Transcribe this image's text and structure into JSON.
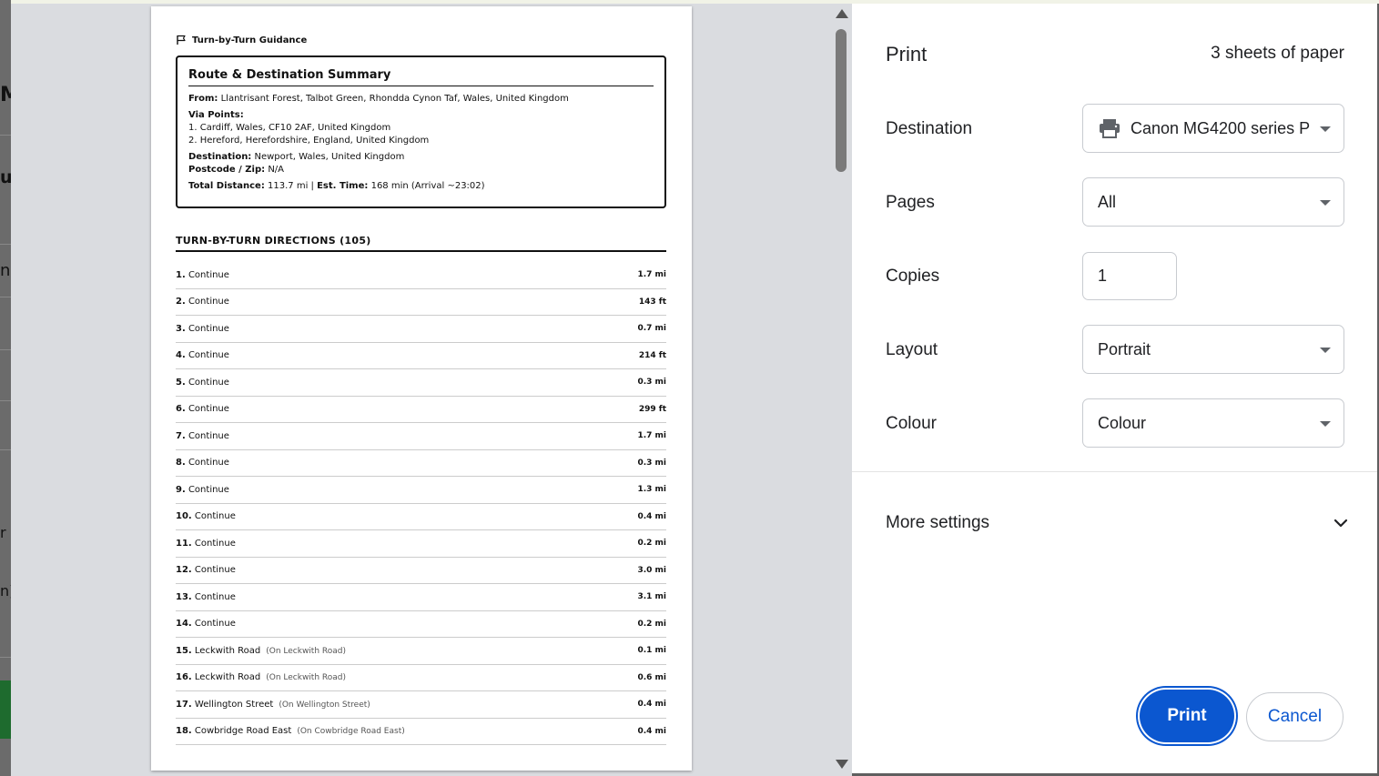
{
  "background_page": {
    "fragments": [
      "M",
      "u",
      "n",
      "r",
      "n)"
    ]
  },
  "preview": {
    "header": "Turn-by-Turn Guidance",
    "summary": {
      "title": "Route & Destination Summary",
      "from_label": "From:",
      "from_value": "Llantrisant Forest, Talbot Green, Rhondda Cynon Taf, Wales, United Kingdom",
      "via_label": "Via Points:",
      "via_1": "1. Cardiff, Wales, CF10 2AF, United Kingdom",
      "via_2": "2. Hereford, Herefordshire, England, United Kingdom",
      "dest_label": "Destination:",
      "dest_value": "Newport, Wales, United Kingdom",
      "postcode_label": "Postcode / Zip:",
      "postcode_value": "N/A",
      "distance_label": "Total Distance:",
      "distance_value": "113.7 mi |",
      "time_label": "Est. Time:",
      "time_value": "168 min (Arrival ~23:02)"
    },
    "directions_title": "TURN-BY-TURN DIRECTIONS (105)",
    "directions": [
      {
        "num": "1.",
        "text": "Continue",
        "note": "",
        "dist": "1.7 mi"
      },
      {
        "num": "2.",
        "text": "Continue",
        "note": "",
        "dist": "143 ft"
      },
      {
        "num": "3.",
        "text": "Continue",
        "note": "",
        "dist": "0.7 mi"
      },
      {
        "num": "4.",
        "text": "Continue",
        "note": "",
        "dist": "214 ft"
      },
      {
        "num": "5.",
        "text": "Continue",
        "note": "",
        "dist": "0.3 mi"
      },
      {
        "num": "6.",
        "text": "Continue",
        "note": "",
        "dist": "299 ft"
      },
      {
        "num": "7.",
        "text": "Continue",
        "note": "",
        "dist": "1.7 mi"
      },
      {
        "num": "8.",
        "text": "Continue",
        "note": "",
        "dist": "0.3 mi"
      },
      {
        "num": "9.",
        "text": "Continue",
        "note": "",
        "dist": "1.3 mi"
      },
      {
        "num": "10.",
        "text": "Continue",
        "note": "",
        "dist": "0.4 mi"
      },
      {
        "num": "11.",
        "text": "Continue",
        "note": "",
        "dist": "0.2 mi"
      },
      {
        "num": "12.",
        "text": "Continue",
        "note": "",
        "dist": "3.0 mi"
      },
      {
        "num": "13.",
        "text": "Continue",
        "note": "",
        "dist": "3.1 mi"
      },
      {
        "num": "14.",
        "text": "Continue",
        "note": "",
        "dist": "0.2 mi"
      },
      {
        "num": "15.",
        "text": "Leckwith Road",
        "note": "(On Leckwith Road)",
        "dist": "0.1 mi"
      },
      {
        "num": "16.",
        "text": "Leckwith Road",
        "note": "(On Leckwith Road)",
        "dist": "0.6 mi"
      },
      {
        "num": "17.",
        "text": "Wellington Street",
        "note": "(On Wellington Street)",
        "dist": "0.4 mi"
      },
      {
        "num": "18.",
        "text": "Cowbridge Road East",
        "note": "(On Cowbridge Road East)",
        "dist": "0.4 mi"
      }
    ]
  },
  "panel": {
    "title": "Print",
    "sheets": "3 sheets of paper",
    "destination_label": "Destination",
    "destination_value": "Canon MG4200 series P",
    "pages_label": "Pages",
    "pages_value": "All",
    "copies_label": "Copies",
    "copies_value": "1",
    "layout_label": "Layout",
    "layout_value": "Portrait",
    "colour_label": "Colour",
    "colour_value": "Colour",
    "more_settings": "More settings",
    "print_button": "Print",
    "cancel_button": "Cancel"
  },
  "colors": {
    "accent": "#0b57d0",
    "preview_bg": "#dadce0"
  }
}
